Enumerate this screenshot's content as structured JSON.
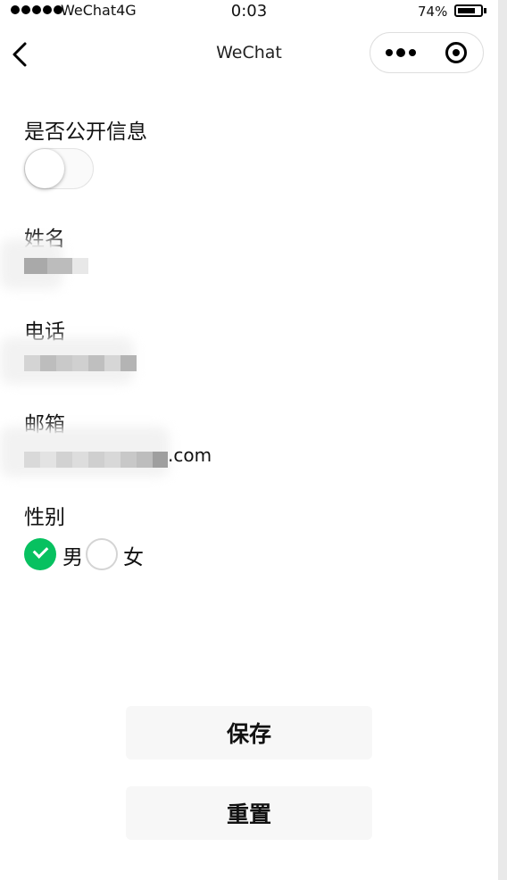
{
  "status_bar": {
    "carrier": "WeChat4G",
    "time": "0:03",
    "battery_percent": "74%",
    "battery_level": 0.74
  },
  "navbar": {
    "title": "WeChat",
    "back_icon": "chevron-left-icon",
    "more_icon": "more-dots-icon",
    "close_icon": "target-circle-icon"
  },
  "form": {
    "public_info": {
      "label": "是否公开信息",
      "checked": false
    },
    "name": {
      "label": "姓名"
    },
    "phone": {
      "label": "电话"
    },
    "email": {
      "label": "邮箱",
      "visible_suffix": ".com"
    },
    "gender": {
      "label": "性别",
      "options": [
        {
          "label": "男",
          "selected": true
        },
        {
          "label": "女",
          "selected": false
        }
      ]
    }
  },
  "buttons": {
    "save": "保存",
    "reset": "重置"
  },
  "colors": {
    "accent_green": "#07c160",
    "button_bg": "#f7f7f7"
  }
}
